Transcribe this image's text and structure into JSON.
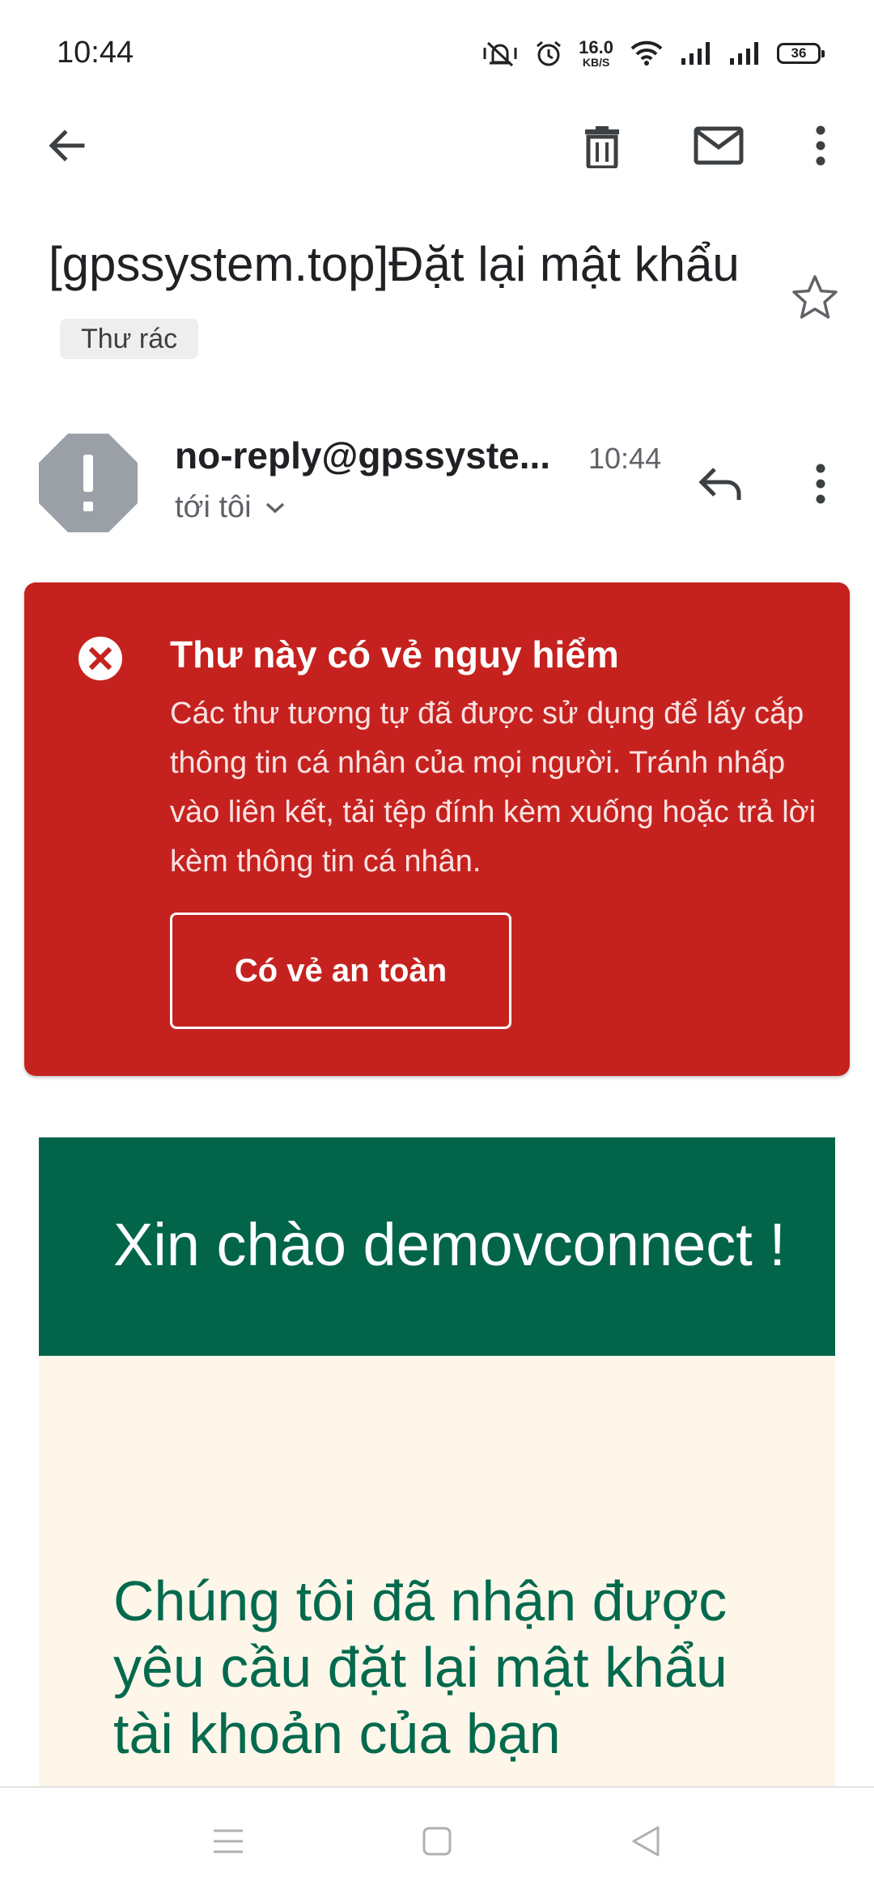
{
  "status_bar": {
    "time": "10:44",
    "net_speed_value": "16.0",
    "net_speed_unit": "KB/S",
    "battery": "36"
  },
  "toolbar": {
    "back_icon": "arrow-left-icon",
    "delete_icon": "trash-icon",
    "mark_unread_icon": "mail-icon",
    "more_icon": "more-vertical-icon"
  },
  "email": {
    "subject": "[gpssystem.top]Đặt lại mật khẩu",
    "label": "Thư rác",
    "sender": "no-reply@gpssyste...",
    "time": "10:44",
    "recipient": "tới tôi"
  },
  "warning": {
    "title": "Thư này có vẻ nguy hiểm",
    "body": "Các thư tương tự đã được sử dụng để lấy cắp thông tin cá nhân của mọi người. Tránh nhấp vào liên kết, tải tệp đính kèm xuống hoặc trả lời kèm thông tin cá nhân.",
    "button_label": "Có vẻ an toàn"
  },
  "body": {
    "greeting": "Xin chào demovconnect !",
    "heading": "Chúng tôi đã nhận được yêu cầu đặt lại mật khẩu tài khoản của bạn"
  },
  "colors": {
    "warning_bg": "#c5221f",
    "brand_green": "#02654a",
    "content_bg": "#fdf6e9"
  }
}
